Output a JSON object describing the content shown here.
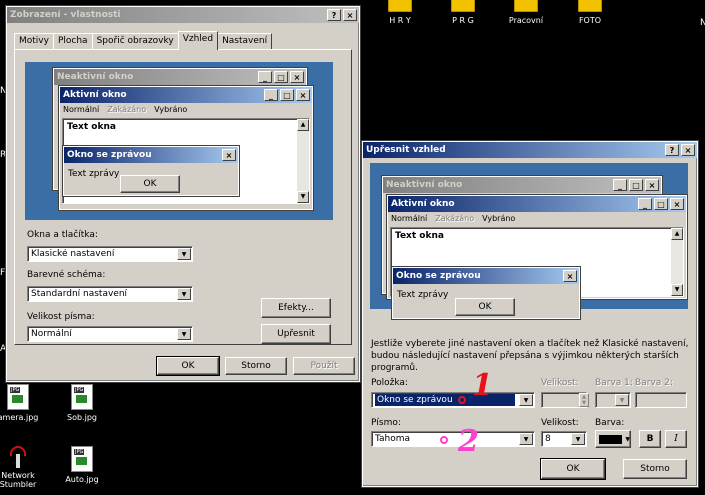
{
  "desktop": {
    "icons": [
      {
        "label": "H R Y"
      },
      {
        "label": "P R G"
      },
      {
        "label": "Pracovní"
      },
      {
        "label": "FOTO"
      },
      {
        "label": "amera.jpg"
      },
      {
        "label": "Sob.jpg"
      },
      {
        "label": "Network Stumbler"
      },
      {
        "label": "Auto.jpg"
      }
    ],
    "edge_letters": [
      "N",
      "R",
      "F",
      "A"
    ],
    "file_tag": "JPG"
  },
  "display_props": {
    "title": "Zobrazení - vlastnosti",
    "help": "?",
    "close": "×",
    "tabs": [
      "Motivy",
      "Plocha",
      "Spořič obrazovky",
      "Vzhled",
      "Nastavení"
    ],
    "active_tab": "Vzhled",
    "preview": {
      "inactive_title": "Neaktivní okno",
      "active_title": "Aktivní okno",
      "menu_normal": "Normální",
      "menu_disabled": "Zakázáno",
      "menu_selected": "Vybráno",
      "window_text": "Text okna",
      "msg_title": "Okno se zprávou",
      "msg_text": "Text zprávy",
      "ok": "OK"
    },
    "windows_buttons_label": "Okna a tlačítka:",
    "windows_buttons_value": "Klasické nastavení",
    "color_scheme_label": "Barevné schéma:",
    "color_scheme_value": "Standardní nastavení",
    "font_size_label": "Velikost písma:",
    "font_size_value": "Normální",
    "effects_button": "Efekty...",
    "advanced_button": "Upřesnit",
    "ok": "OK",
    "cancel": "Storno",
    "apply": "Použít"
  },
  "advanced": {
    "title": "Upřesnit vzhled",
    "help": "?",
    "close": "×",
    "preview": {
      "inactive_title": "Neaktivní okno",
      "active_title": "Aktivní okno",
      "menu_normal": "Normální",
      "menu_disabled": "Zakázáno",
      "menu_selected": "Vybráno",
      "window_text": "Text okna",
      "msg_title": "Okno se zprávou",
      "msg_text": "Text zprávy",
      "ok": "OK"
    },
    "note": "Jestliže vyberete jiné nastavení oken a tlačítek než Klasické nastavení, budou následující nastavení přepsána s výjimkou některých starších programů.",
    "item_label": "Položka:",
    "item_value": "Okno se zprávou",
    "size_label": "Velikost:",
    "color1_label": "Barva 1:",
    "color2_label": "Barva 2:",
    "font_label": "Písmo:",
    "font_value": "Tahoma",
    "font_size_label": "Velikost:",
    "font_size_value": "8",
    "font_color_label": "Barva:",
    "bold": "B",
    "italic": "I",
    "ok": "OK",
    "cancel": "Storno"
  },
  "annotations": {
    "one": {
      "text": "1",
      "color": "#e8101a"
    },
    "two": {
      "text": "2",
      "color": "#ff3fd0"
    }
  },
  "colors": {
    "desktop_preview": "#3a6ea5",
    "active_title": "#0a246a",
    "selection": "#0a246a"
  }
}
